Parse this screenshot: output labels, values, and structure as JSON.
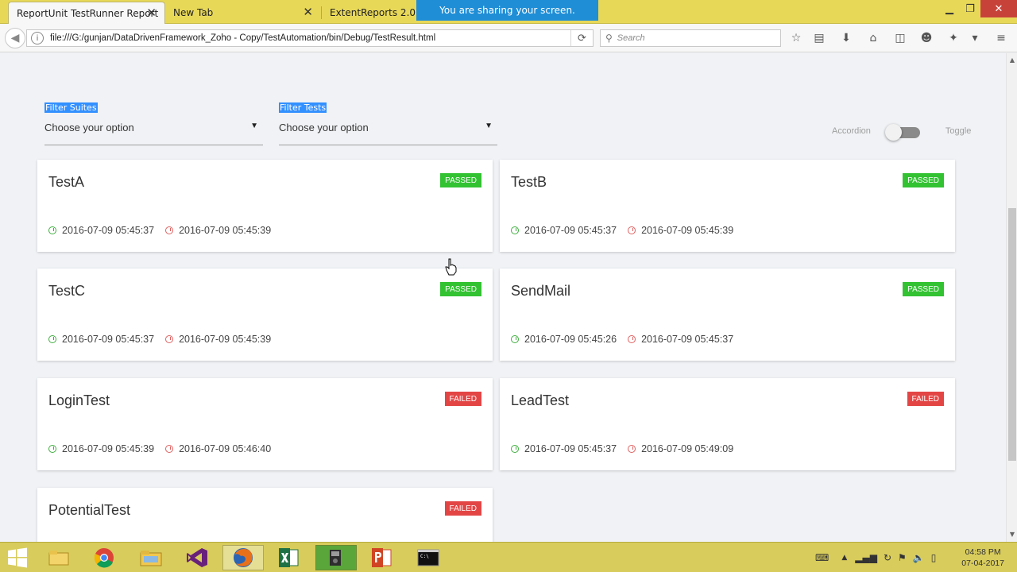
{
  "browser": {
    "tabs": [
      {
        "label": "ReportUnit TestRunner Report",
        "active": true
      },
      {
        "label": "New Tab",
        "active": false
      },
      {
        "label": "ExtentReports 2.0",
        "active": false
      }
    ],
    "share_banner": "You are sharing your screen.",
    "url": "file:///G:/gunjan/DataDrivenFramework_Zoho - Copy/TestAutomation/bin/Debug/TestResult.html",
    "search_placeholder": "Search"
  },
  "filters": {
    "suites": {
      "label": "Filter Suites",
      "value": "Choose your option"
    },
    "tests": {
      "label": "Filter Tests",
      "value": "Choose your option"
    }
  },
  "view_toggle": {
    "left_label": "Accordion",
    "right_label": "Toggle"
  },
  "tests": [
    {
      "name": "TestA",
      "status": "PASSED",
      "start": "2016-07-09 05:45:37",
      "end": "2016-07-09 05:45:39"
    },
    {
      "name": "TestB",
      "status": "PASSED",
      "start": "2016-07-09 05:45:37",
      "end": "2016-07-09 05:45:39"
    },
    {
      "name": "TestC",
      "status": "PASSED",
      "start": "2016-07-09 05:45:37",
      "end": "2016-07-09 05:45:39"
    },
    {
      "name": "SendMail",
      "status": "PASSED",
      "start": "2016-07-09 05:45:26",
      "end": "2016-07-09 05:45:37"
    },
    {
      "name": "LoginTest",
      "status": "FAILED",
      "start": "2016-07-09 05:45:39",
      "end": "2016-07-09 05:46:40"
    },
    {
      "name": "LeadTest",
      "status": "FAILED",
      "start": "2016-07-09 05:45:37",
      "end": "2016-07-09 05:49:09"
    },
    {
      "name": "PotentialTest",
      "status": "FAILED",
      "start": "",
      "end": ""
    }
  ],
  "colors": {
    "passed": "#32c232",
    "failed": "#e34545",
    "selection": "#3390ff"
  },
  "taskbar": {
    "apps": [
      "file-explorer-icon",
      "chrome-icon",
      "folder-icon",
      "visual-studio-icon",
      "firefox-icon",
      "excel-icon",
      "camtasia-icon",
      "powerpoint-icon",
      "cmd-icon"
    ],
    "time": "04:58 PM",
    "date": "07-04-2017"
  }
}
